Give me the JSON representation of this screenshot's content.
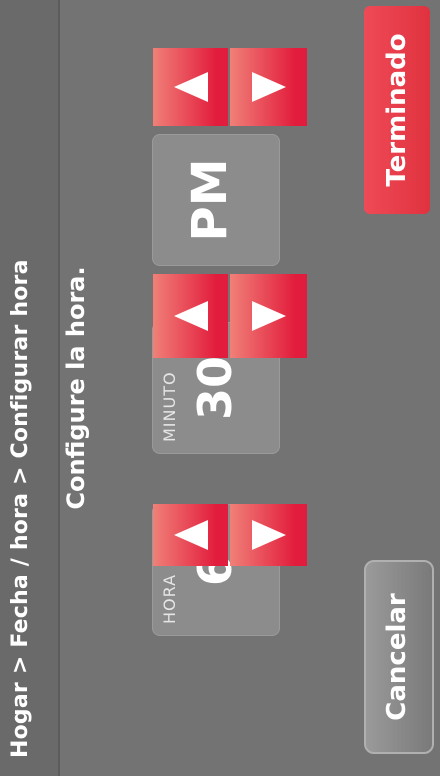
{
  "breadcrumb": "Hogar > Fecha / hora > Configurar hora",
  "subtitle": "Configure la hora.",
  "hour": {
    "label": "HORA",
    "value": "6"
  },
  "minute": {
    "label": "MINUTO",
    "value": "30"
  },
  "ampm": {
    "label": "",
    "value": "PM"
  },
  "buttons": {
    "cancel": "Cancelar",
    "done": "Terminado"
  },
  "colors": {
    "background": "#737373",
    "accent": "#e21c3c",
    "panel": "#8c8c8c"
  },
  "icons": {
    "up": "triangle-up-icon",
    "down": "triangle-down-icon"
  }
}
